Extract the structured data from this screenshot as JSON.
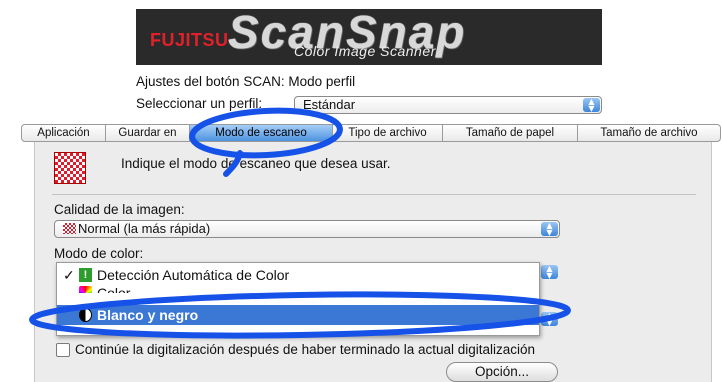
{
  "banner": {
    "brand": "FUJITSU",
    "product": "ScanSnap",
    "subtitle": "Color Image Scanner"
  },
  "header": {
    "scan_settings": "Ajustes del botón SCAN: Modo perfil",
    "profile_label": "Seleccionar un perfil:",
    "profile_value": "Estándar"
  },
  "tabs": [
    {
      "label": "Aplicación"
    },
    {
      "label": "Guardar en"
    },
    {
      "label": "Modo de escaneo",
      "active": true
    },
    {
      "label": "Tipo de archivo"
    },
    {
      "label": "Tamaño de papel"
    },
    {
      "label": "Tamaño de archivo"
    }
  ],
  "panel": {
    "instruction": "Indique el modo de escaneo que desea usar.",
    "quality_label": "Calidad de la imagen:",
    "quality_value": "Normal (la más rápida)",
    "color_label": "Modo de color:",
    "color_menu": [
      {
        "label": "Detección Automática de Color",
        "checked": true
      },
      {
        "label": "Color"
      },
      {
        "label": "Blanco y negro",
        "highlighted": true
      }
    ],
    "continue_label": "Continúe la digitalización después  de haber terminado la actual digitalización",
    "option_button": "Opción..."
  },
  "colors": {
    "highlight_ring": "#1652e8",
    "menu_selection": "#3b78d6",
    "tab_active": "#4e93e0"
  }
}
